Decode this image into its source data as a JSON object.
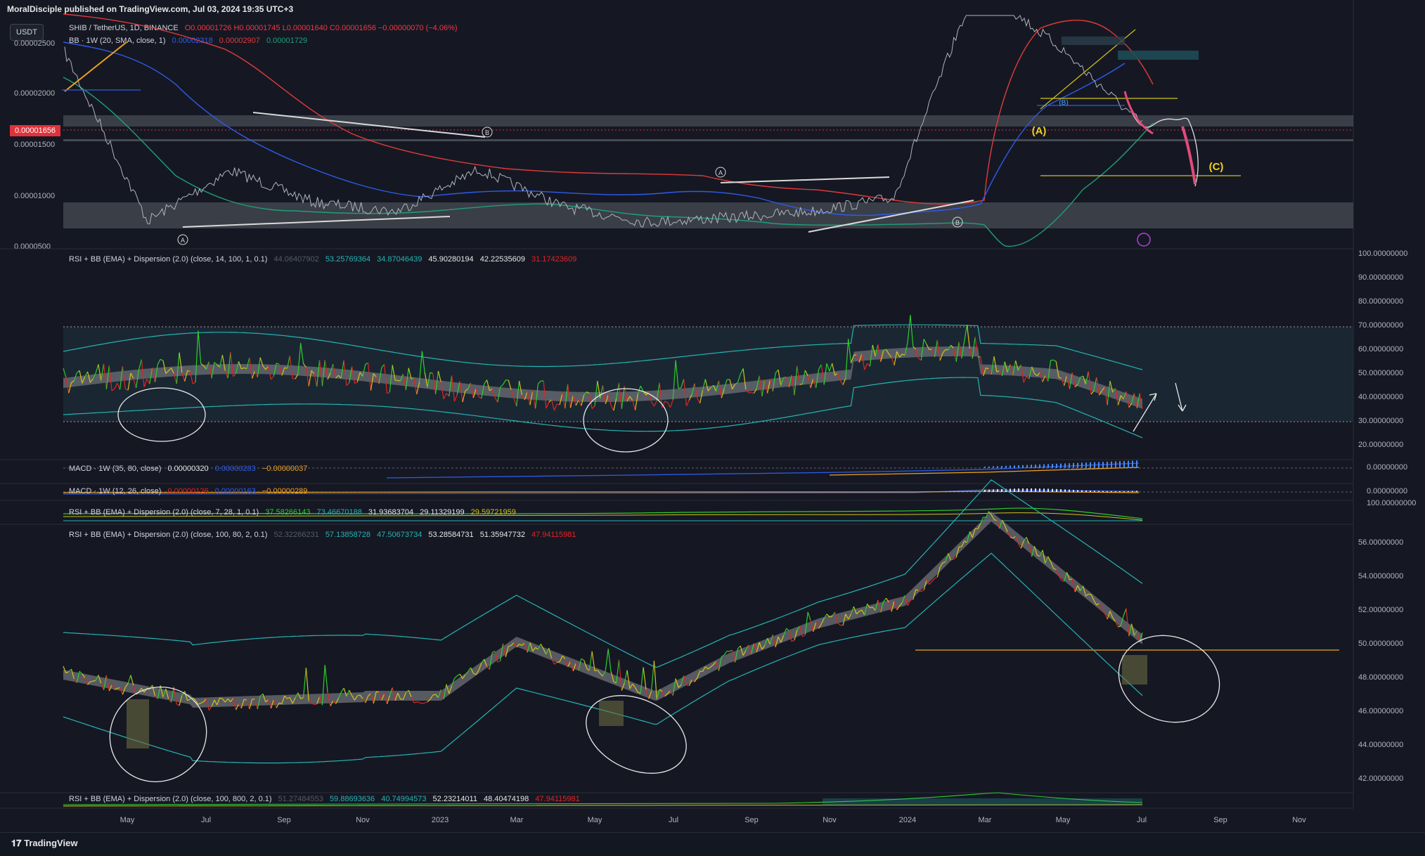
{
  "header": "MoralDisciple published on TradingView.com, Jul 03, 2024 19:35 UTC+3",
  "currency_button": "USDT",
  "brand": "TradingView",
  "price_panel": {
    "legend_symbol": "SHIB / TetherUS, 1D, BINANCE",
    "legend_ohlc": "O0.00001726  H0.00001745  L0.00001640  C0.00001656  −0.00000070 (−4.06%)",
    "legend_bb_title": "BB · 1W (20, SMA, close, 1)",
    "legend_bb_basis": "0.00002318",
    "legend_bb_upper": "0.00002907",
    "legend_bb_lower": "0.00001729",
    "y_ticks": [
      "0.0000500",
      "0.00001000",
      "0.00001500",
      "0.00002000",
      "0.00002500"
    ],
    "current_price": "0.00001656",
    "labels": {
      "A1": "A",
      "B1": "B",
      "A2": "A",
      "B2": "B",
      "bigA": "(A)",
      "bigC": "(C)",
      "b": "(B)"
    }
  },
  "rsi_panel": {
    "legend_title": "RSI + BB (EMA) + Dispersion (2.0) (close, 14, 100, 1, 0.1)",
    "legend_values": [
      "44.06407902",
      "53.25769364",
      "34.87046439",
      "45.90280194",
      "42.22535609",
      "31.17423609"
    ],
    "y_ticks": [
      "20.00000000",
      "30.00000000",
      "40.00000000",
      "50.00000000",
      "60.00000000",
      "70.00000000",
      "80.00000000",
      "90.00000000",
      "100.00000000"
    ]
  },
  "macd1": {
    "legend_title": "MACD · 1W (35, 80, close)",
    "legend_values": [
      "0.00000320",
      "0.00000283",
      "−0.00000037"
    ],
    "y_tick": "0.00000000"
  },
  "macd2": {
    "legend_title": "MACD · 1W (12, 26, close)",
    "legend_values": [
      "0.00000126",
      "0.00000163",
      "−0.00000289"
    ],
    "y_tick": "0.00000000"
  },
  "rsi_small": {
    "legend_title": "RSI + BB (EMA) + Dispersion (2.0) (close, 7, 28, 1, 0.1)",
    "legend_values": [
      "37.58266143",
      "73.46670188",
      "31.93683704",
      "29.11329199",
      "29.59721959"
    ],
    "y_tick": "100.00000000"
  },
  "rsi_long": {
    "legend_title": "RSI + BB (EMA) + Dispersion (2.0) (close, 100, 80, 2, 0.1)",
    "legend_values": [
      "52.32266231",
      "57.13858728",
      "47.50673734",
      "53.28584731",
      "51.35947732",
      "47.94115981"
    ],
    "y_ticks": [
      "42.00000000",
      "44.00000000",
      "46.00000000",
      "48.00000000",
      "50.00000000",
      "52.00000000",
      "54.00000000",
      "56.00000000"
    ]
  },
  "rsi_bottom": {
    "legend_title": "RSI + BB (EMA) + Dispersion (2.0) (close, 100, 800, 2, 0.1)",
    "legend_values": [
      "51.27484553",
      "59.88693636",
      "40.74994573",
      "52.23214011",
      "48.40474198",
      "47.94115981"
    ]
  },
  "x_axis": [
    "May",
    "Jul",
    "Sep",
    "Nov",
    "2023",
    "Mar",
    "May",
    "Jul",
    "Sep",
    "Nov",
    "2024",
    "Mar",
    "May",
    "Jul",
    "Sep",
    "Nov"
  ],
  "colors": {
    "background": "#151823",
    "rsi_up": "#2ecc2e",
    "rsi_down": "#e02424",
    "rsi_mid": "#d4c21a",
    "bb_upper": "#e03a3a",
    "bb_basis": "#2f5be8",
    "bb_lower": "#1f9e7a",
    "teal_band": "#26b3b3",
    "price_label_bg": "#e0323a",
    "projection": "#e24a7a"
  },
  "chart_data": {
    "type": "line",
    "title": "SHIB / TetherUS, 1D, BINANCE",
    "x": [
      "2022-05",
      "2022-07",
      "2022-09",
      "2022-11",
      "2023-01",
      "2023-03",
      "2023-05",
      "2023-07",
      "2023-09",
      "2023-11",
      "2024-01",
      "2024-03",
      "2024-05",
      "2024-07"
    ],
    "series": [
      {
        "name": "SHIB / TetherUS, 1D, BINANCE",
        "values": [
          2.35e-05,
          7.5e-06,
          1.23e-05,
          9.3e-06,
          8.4e-06,
          1.24e-05,
          8.9e-06,
          7.4e-06,
          7.8e-06,
          8.4e-06,
          9.7e-06,
          3e-05,
          2.4e-05,
          1.66e-05
        ]
      }
    ],
    "ylim": [
      5e-06,
      2.7e-05
    ]
  }
}
